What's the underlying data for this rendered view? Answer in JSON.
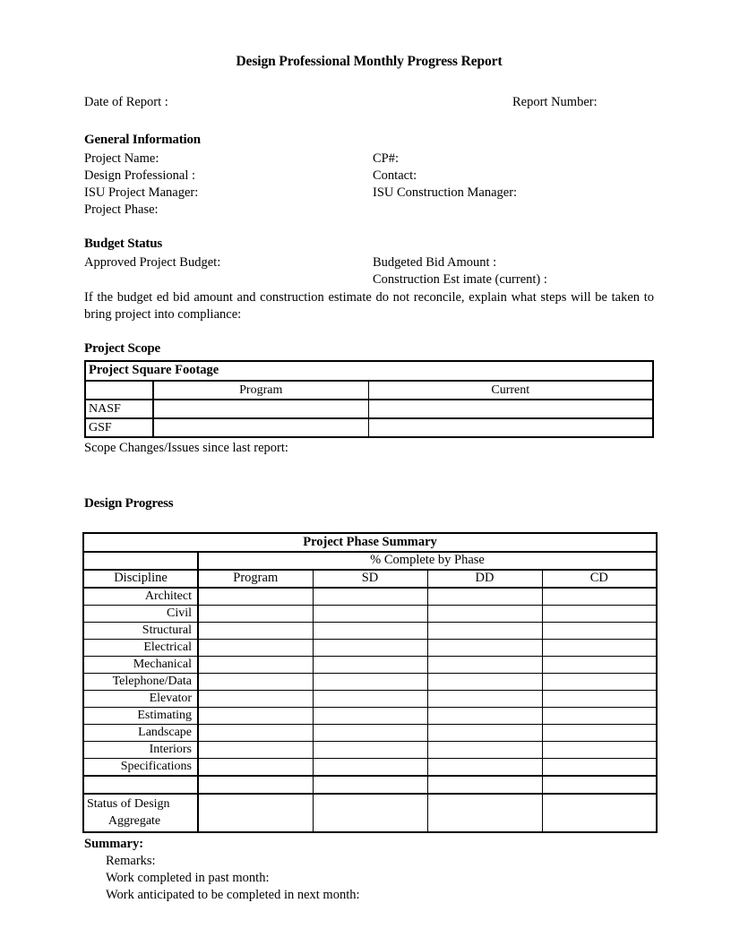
{
  "document": {
    "title": "Design Professional Monthly Progress Report",
    "date_of_report_label": "Date of Report :",
    "report_number_label": "Report Number:"
  },
  "general_information": {
    "heading": "General Information",
    "rows": [
      {
        "left": "Project Name:",
        "right": "CP#:"
      },
      {
        "left": "Design  Professional :",
        "right": "Contact:"
      },
      {
        "left": "ISU Project Manager:",
        "right": "ISU Construction Manager:"
      },
      {
        "left": "Project Phase:",
        "right": ""
      }
    ]
  },
  "budget_status": {
    "heading": "Budget Status",
    "rows": [
      {
        "left": "Approved Project Budget:",
        "right": "Budgeted Bid Amount  :"
      },
      {
        "left": "",
        "right": "Construction Est imate  (current) :"
      }
    ],
    "reconcile_note": "If the budget ed bid amount  and construction estimate do not reconcile, explain what steps will be taken to bring project into compliance:"
  },
  "project_scope": {
    "heading": "Project Scope",
    "table": {
      "caption": "Project Square Footage",
      "columns": [
        "",
        "Program",
        "Current"
      ],
      "rows": [
        {
          "label": "NASF",
          "program": "",
          "current": ""
        },
        {
          "label": "GSF",
          "program": "",
          "current": ""
        }
      ]
    },
    "scope_changes_label": "Scope Changes/Issues since last report:"
  },
  "design_progress": {
    "heading": "Design Progress",
    "table": {
      "caption": "Project Phase Summary",
      "group_header": "% Complete by Phase",
      "columns": [
        "Discipline",
        "Program",
        "SD",
        "DD",
        "CD"
      ],
      "rows": [
        {
          "discipline": "Architect",
          "program": "",
          "sd": "",
          "dd": "",
          "cd": ""
        },
        {
          "discipline": "Civil",
          "program": "",
          "sd": "",
          "dd": "",
          "cd": ""
        },
        {
          "discipline": "Structural",
          "program": "",
          "sd": "",
          "dd": "",
          "cd": ""
        },
        {
          "discipline": "Electrical",
          "program": "",
          "sd": "",
          "dd": "",
          "cd": ""
        },
        {
          "discipline": "Mechanical",
          "program": "",
          "sd": "",
          "dd": "",
          "cd": ""
        },
        {
          "discipline": "Telephone/Data",
          "program": "",
          "sd": "",
          "dd": "",
          "cd": ""
        },
        {
          "discipline": "Elevator",
          "program": "",
          "sd": "",
          "dd": "",
          "cd": ""
        },
        {
          "discipline": "Estimating",
          "program": "",
          "sd": "",
          "dd": "",
          "cd": ""
        },
        {
          "discipline": "Landscape",
          "program": "",
          "sd": "",
          "dd": "",
          "cd": ""
        },
        {
          "discipline": "Interiors",
          "program": "",
          "sd": "",
          "dd": "",
          "cd": ""
        },
        {
          "discipline": "Specifications",
          "program": "",
          "sd": "",
          "dd": "",
          "cd": ""
        }
      ],
      "spacer_row": {
        "discipline": "",
        "program": "",
        "sd": "",
        "dd": "",
        "cd": ""
      },
      "status_row": {
        "label_line1": "Status of Design",
        "label_line2": "Aggregate",
        "program": "",
        "sd": "",
        "dd": "",
        "cd": ""
      }
    }
  },
  "summary": {
    "heading": "Summary:",
    "lines": [
      "Remarks:",
      "Work completed in past month:",
      "Work anticipated to be completed in next month:"
    ]
  },
  "colors": {
    "text": "#000000",
    "background": "#ffffff",
    "border": "#000000"
  }
}
